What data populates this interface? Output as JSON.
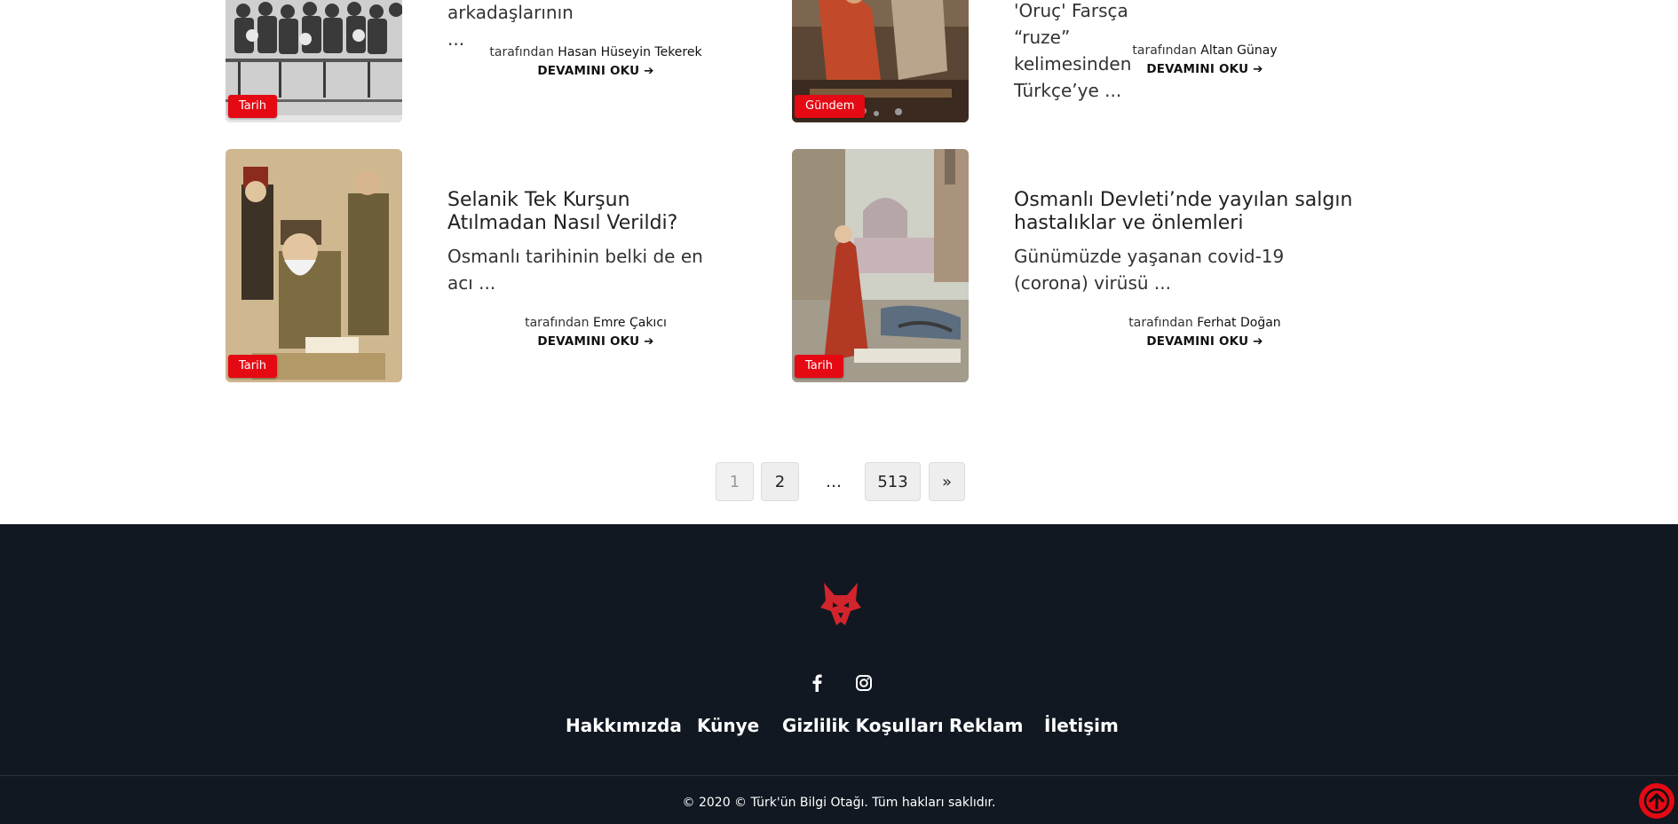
{
  "articles": [
    {
      "title": "",
      "excerpt": "arkadaşlarının ...",
      "by": "tarafından",
      "author": "Hasan Hüseyin Tekerek",
      "more": "DEVAMINI OKU",
      "category": "Tarih"
    },
    {
      "title": "",
      "excerpt": "'Oruç' Farsça “ruze” kelimesinden Türkçe’ye ...",
      "by": "tarafından",
      "author": "Altan Günay",
      "more": "DEVAMINI OKU",
      "category": "Gündem"
    },
    {
      "title": "Selanik Tek Kurşun Atılmadan Nasıl Verildi?",
      "excerpt": "Osmanlı tarihinin belki de en acı ...",
      "by": "tarafından",
      "author": "Emre Çakıcı",
      "more": "DEVAMINI OKU",
      "category": "Tarih"
    },
    {
      "title": "Osmanlı Devleti’nde yayılan salgın hastalıklar ve önlemleri",
      "excerpt": "Günümüzde yaşanan covid-19 (corona) virüsü ...",
      "by": "tarafından",
      "author": "Ferhat Doğan",
      "more": "DEVAMINI OKU",
      "category": "Tarih"
    }
  ],
  "pagination": {
    "current": "1",
    "next_page": "2",
    "dots": "…",
    "last": "513",
    "next": "»"
  },
  "footer": {
    "social": [
      "facebook-icon",
      "instagram-icon"
    ],
    "links": [
      "Hakkımızda",
      "Künye",
      "Gizlilik Koşulları",
      "Reklam",
      "İletişim"
    ],
    "copyright": "© 2020 © Türk'ün Bilgi Otağı. Tüm hakları saklıdır."
  },
  "colors": {
    "accent": "#e50914",
    "footer_bg": "#111821"
  }
}
